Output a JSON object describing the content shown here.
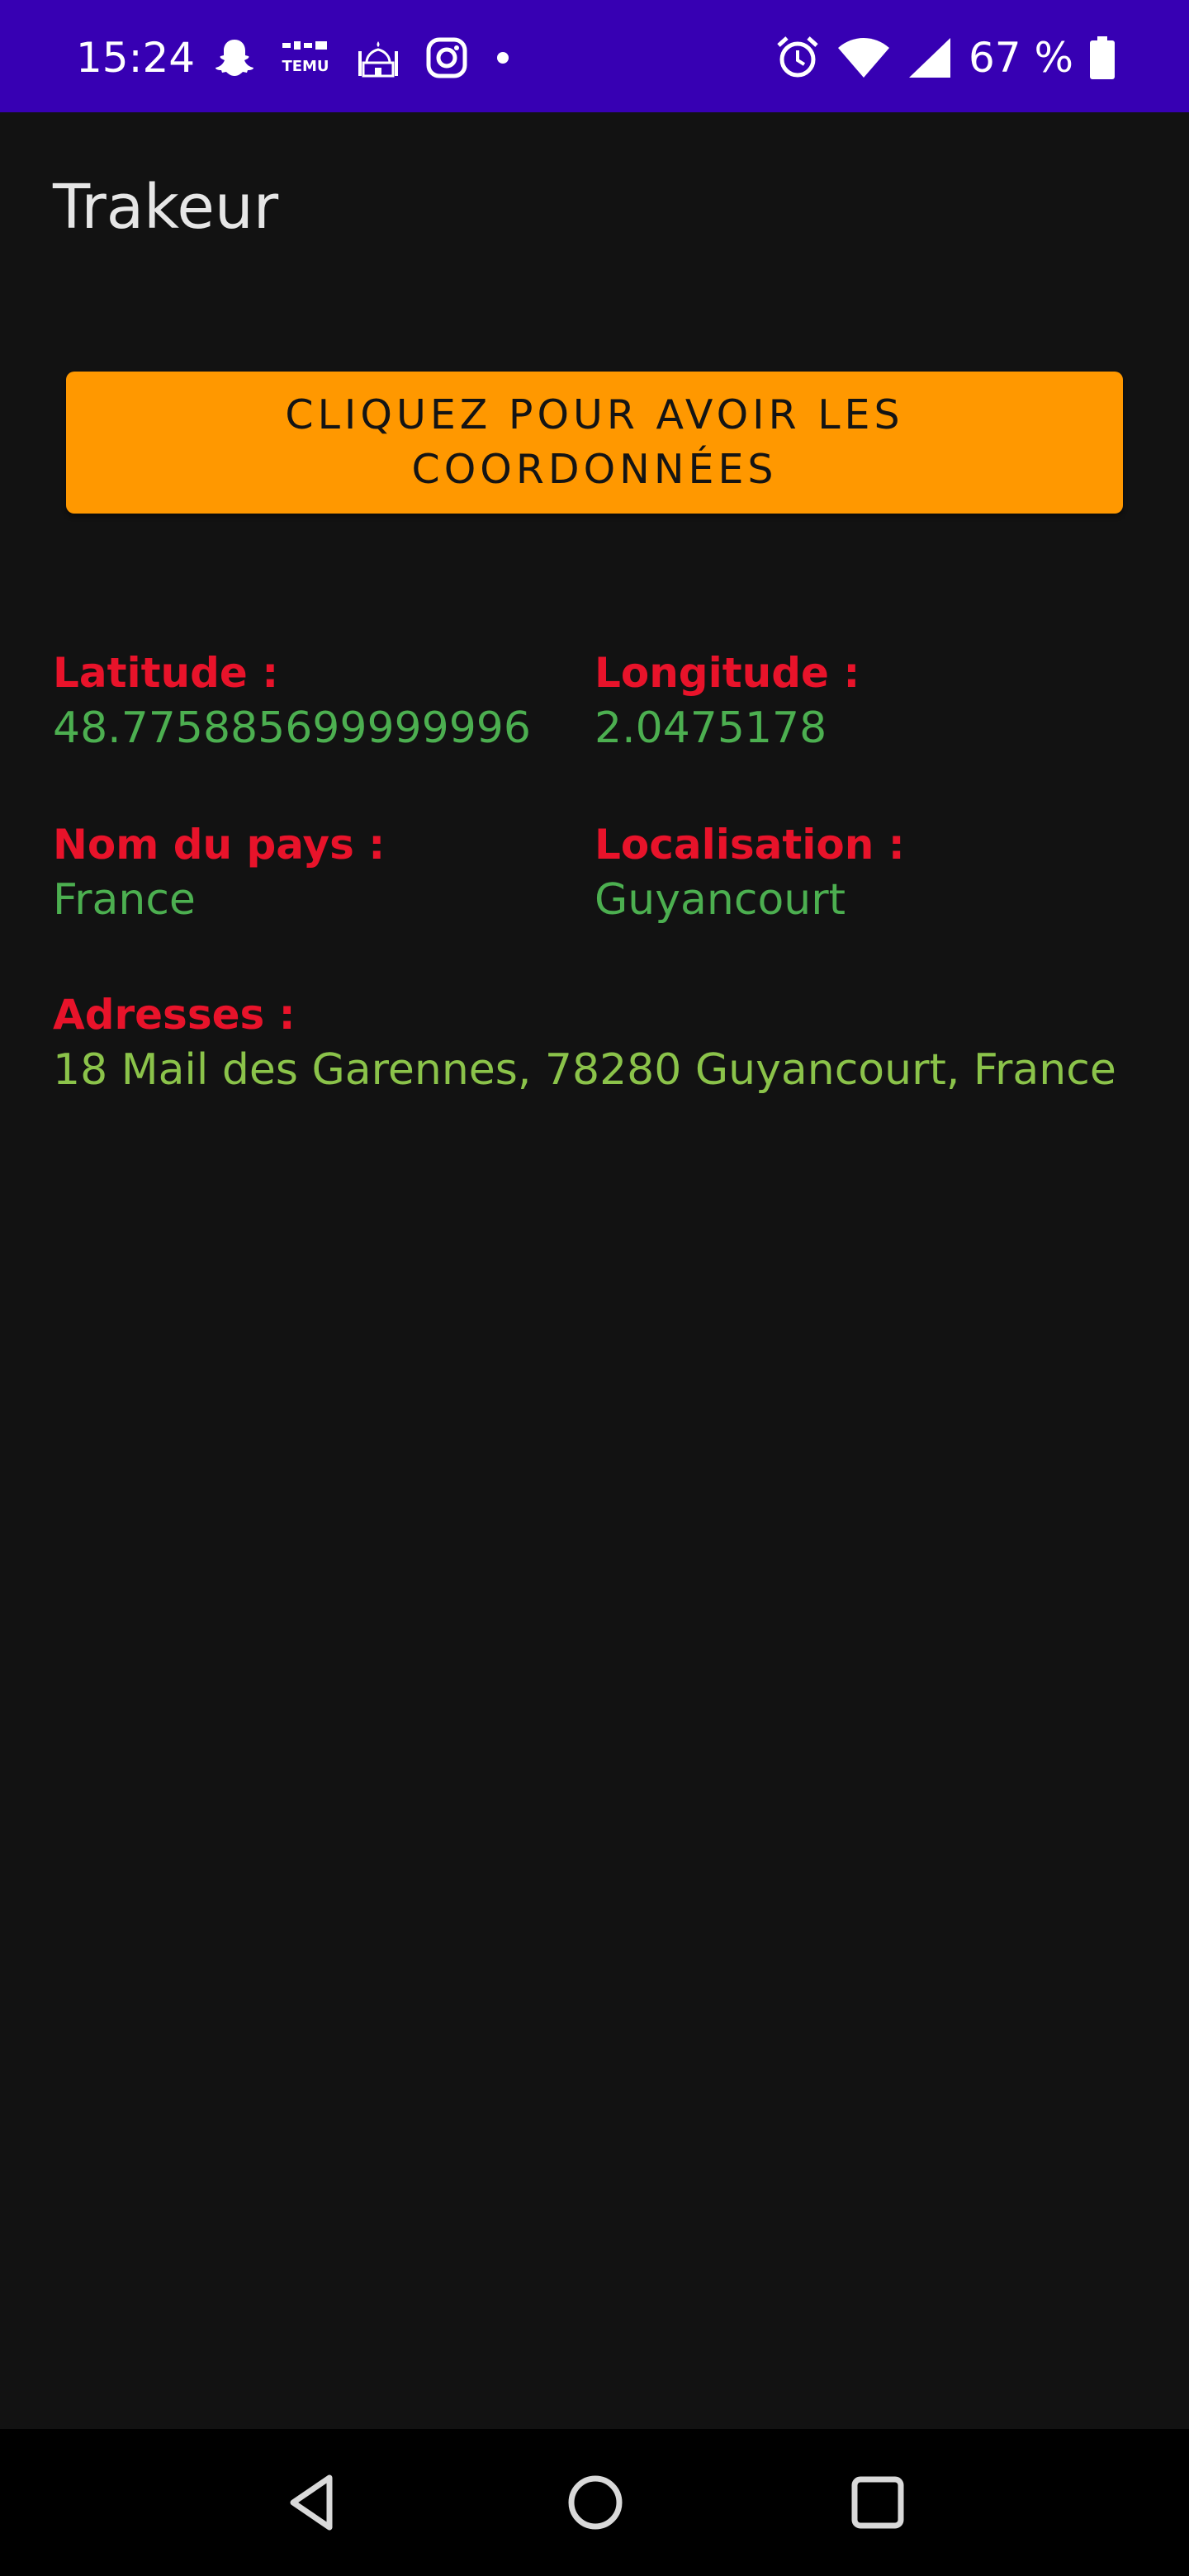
{
  "status_bar": {
    "time": "15:24",
    "battery_text": "67 %",
    "bg_color": "#3700B3",
    "left_icons": [
      "snapchat-icon",
      "temu-icon",
      "mosque-icon",
      "instagram-icon",
      "notification-dot-icon"
    ],
    "right_icons": [
      "alarm-icon",
      "wifi-icon",
      "signal-icon",
      "battery-icon"
    ]
  },
  "app": {
    "title": "Trakeur"
  },
  "button": {
    "label": "CLIQUEZ POUR AVOIR LES COORDONNÉES",
    "bg_color": "#FF9800"
  },
  "fields": {
    "latitude": {
      "label": "Latitude :",
      "value": "48.775885699999996"
    },
    "longitude": {
      "label": "Longitude :",
      "value": "2.0475178"
    },
    "country": {
      "label": "Nom du pays :",
      "value": "France"
    },
    "locality": {
      "label": "Localisation :",
      "value": "Guyancourt"
    },
    "address": {
      "label": "Adresses :",
      "value": "18 Mail des Garennes, 78280 Guyancourt, France"
    }
  },
  "colors": {
    "background": "#121212",
    "label": "#E8132A",
    "value": "#4CAF50"
  },
  "nav_bar": {
    "icons": [
      "back-icon",
      "home-icon",
      "recents-icon"
    ]
  }
}
